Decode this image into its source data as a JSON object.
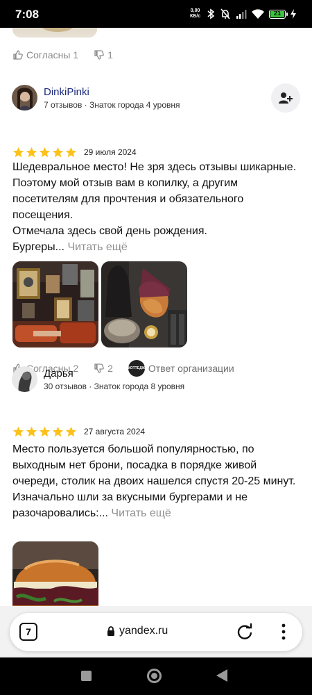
{
  "status_bar": {
    "time": "7:08",
    "net_speed_value": "0,00",
    "net_speed_unit": "КБ/с",
    "battery_level": "21"
  },
  "previous_review": {
    "agree_label": "Согласны 1",
    "dislike_count": "1"
  },
  "reviews": [
    {
      "author": "DinkiPinki",
      "author_color": "#1a2a7a",
      "meta": "7 отзывов · Знаток города 4 уровня",
      "rating": 5,
      "date": "29 июля 2024",
      "text_lines": [
        "Шедевральное место! Не зря здесь отзывы шикарные. Поэтому мой отзыв вам в копилку, а другим посетителям для прочтения и обязательного посещения.",
        "Отмечала здесь свой день рождения.",
        "Бургеры..."
      ],
      "read_more": "Читать ещё",
      "photos": [
        "interior-paintings-photo",
        "gnome-decor-photo"
      ],
      "agree_label": "Согласны 2",
      "dislike_count": "2",
      "org_reply_label": "Ответ организации",
      "org_logo_text": "КОТТЕДЖ"
    },
    {
      "author": "Дарья",
      "author_color": "#111111",
      "meta": "30 отзывов · Знаток города 8 уровня",
      "rating": 5,
      "date": "27 августа 2024",
      "text_lines": [
        "Место пользуется большой популярностью, по выходным нет брони, посадка в порядке живой очереди, столик на двоих нашелся спустя 20-25 минут.",
        "Изначально шли за вкусными бургерами и не разочаровались:..."
      ],
      "read_more": "Читать ещё",
      "photos": [
        "burger-photo"
      ]
    }
  ],
  "browser": {
    "tab_count": "7",
    "url": "yandex.ru"
  },
  "colors": {
    "star": "#fcc21b",
    "muted": "#8a8a8a",
    "subscribe_bg": "#f0f0f2"
  }
}
